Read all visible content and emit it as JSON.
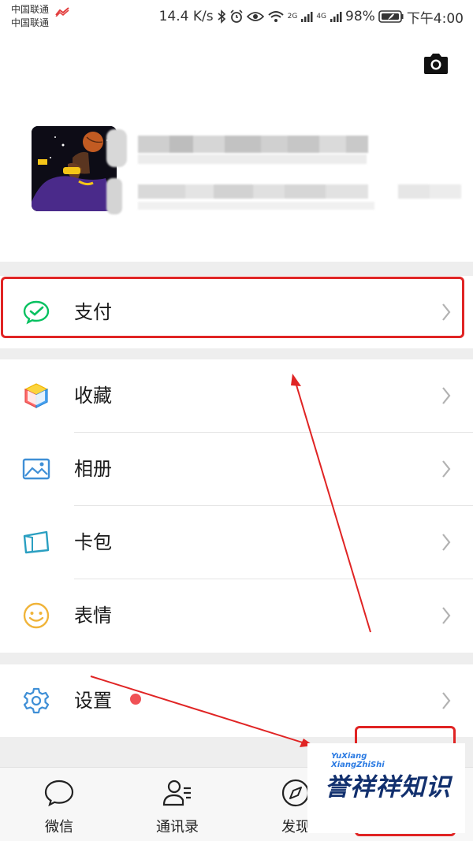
{
  "status_bar": {
    "carrier_1": "中国联通",
    "carrier_2": "中国联通",
    "speed": "14.4 K/s",
    "net_1": "2G",
    "net_2": "4G",
    "battery": "98%",
    "time": "下午4:00"
  },
  "menu": {
    "pay": "支付",
    "favorites": "收藏",
    "album": "相册",
    "cards": "卡包",
    "stickers": "表情",
    "settings": "设置"
  },
  "tabs": {
    "chats": "微信",
    "contacts": "通讯录",
    "discover": "发现"
  },
  "watermark": {
    "line1": "YuXiang",
    "line2": "XiangZhiShi",
    "brand": "誉祥祥知识"
  },
  "colors": {
    "wechat_green": "#07c160",
    "annotation_red": "#e02424",
    "badge_red": "#f05155",
    "watermark_navy": "#12306e",
    "watermark_blue": "#2a7ae2"
  },
  "icons": [
    "camera-icon",
    "pay-icon",
    "favorites-icon",
    "album-icon",
    "cards-icon",
    "stickers-icon",
    "settings-icon",
    "chats-icon",
    "contacts-icon",
    "discover-icon",
    "chevron-right-icon"
  ]
}
